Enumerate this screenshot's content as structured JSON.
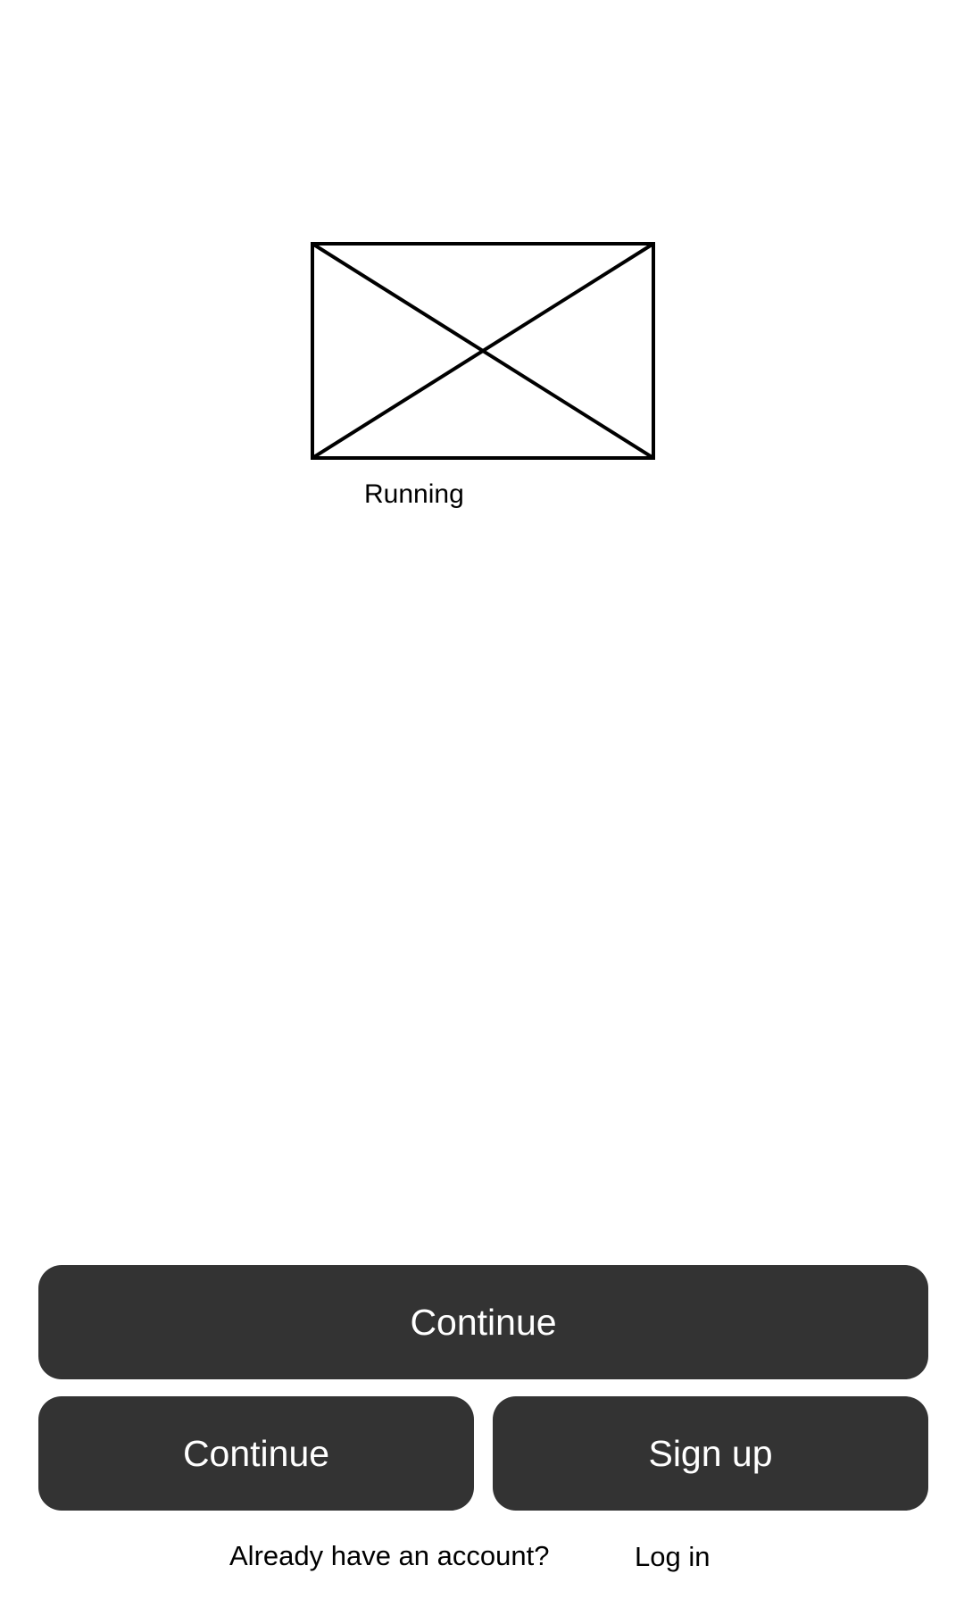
{
  "hero": {
    "image_icon": "image-placeholder-icon",
    "caption": "Running"
  },
  "actions": {
    "primary_label": "Continue",
    "secondary_left_label": "Continue",
    "secondary_right_label": "Sign up"
  },
  "footer": {
    "prompt": "Already have an account?",
    "link_label": "Log in"
  },
  "colors": {
    "background": "#ffffff",
    "button_bg": "#333333",
    "button_text": "#ffffff",
    "text": "#000000"
  }
}
